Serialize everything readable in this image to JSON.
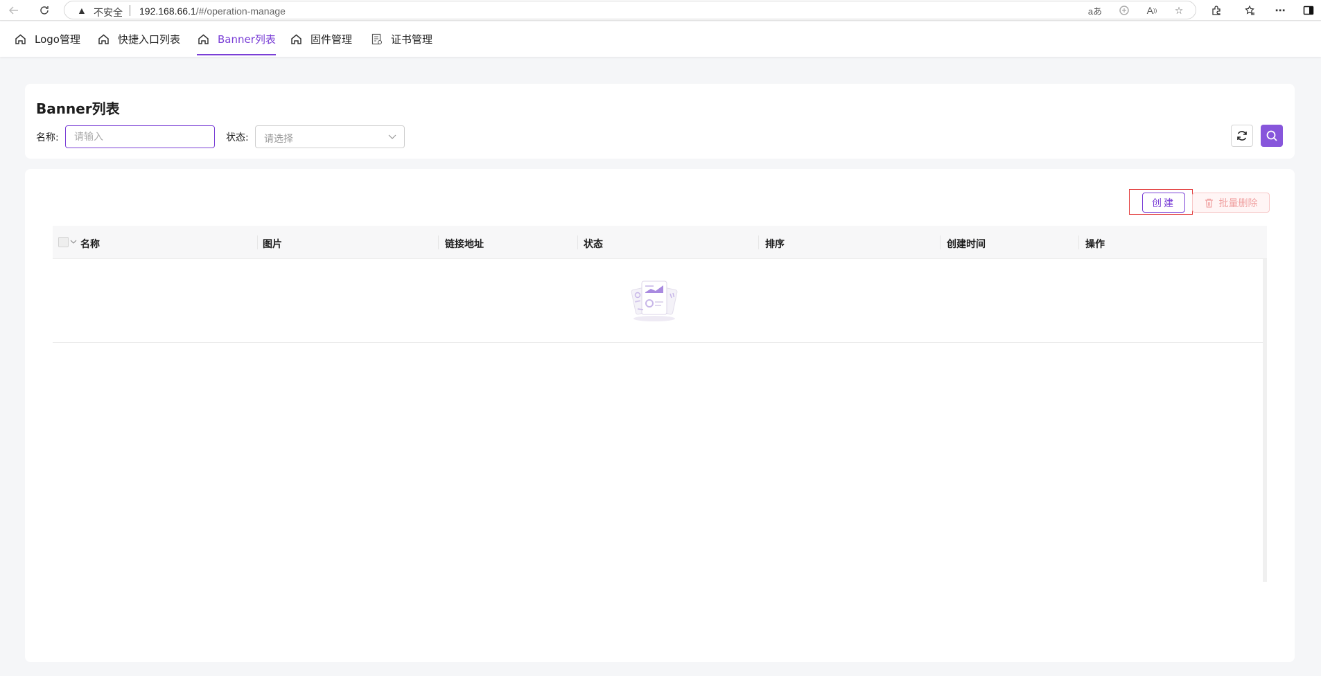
{
  "browser": {
    "security_text": "不安全",
    "url_host": "192.168.66.1",
    "url_path": "/#/operation-manage",
    "tools": {
      "read_aloud": "aあ",
      "aloud": "A"
    }
  },
  "app_tabs": [
    {
      "label": "Logo管理",
      "icon": "home-icon",
      "active": false
    },
    {
      "label": "快捷入口列表",
      "icon": "home-icon",
      "active": false
    },
    {
      "label": "Banner列表",
      "icon": "home-icon",
      "active": true
    },
    {
      "label": "固件管理",
      "icon": "home-icon",
      "active": false
    },
    {
      "label": "证书管理",
      "icon": "certificate-icon",
      "active": false
    }
  ],
  "filter": {
    "title": "Banner列表",
    "name_label": "名称:",
    "name_placeholder": "请输入",
    "name_value": "",
    "status_label": "状态:",
    "status_placeholder": "请选择"
  },
  "toolbar": {
    "create_label": "创建",
    "batch_delete_label": "批量删除"
  },
  "table": {
    "columns": [
      "名称",
      "图片",
      "链接地址",
      "状态",
      "排序",
      "创建时间",
      "操作"
    ],
    "rows": []
  },
  "colors": {
    "accent": "#7a3fd6",
    "accent_button": "#8756db",
    "danger_light": "#f0a3a3",
    "highlight_border": "#e23b3b"
  }
}
